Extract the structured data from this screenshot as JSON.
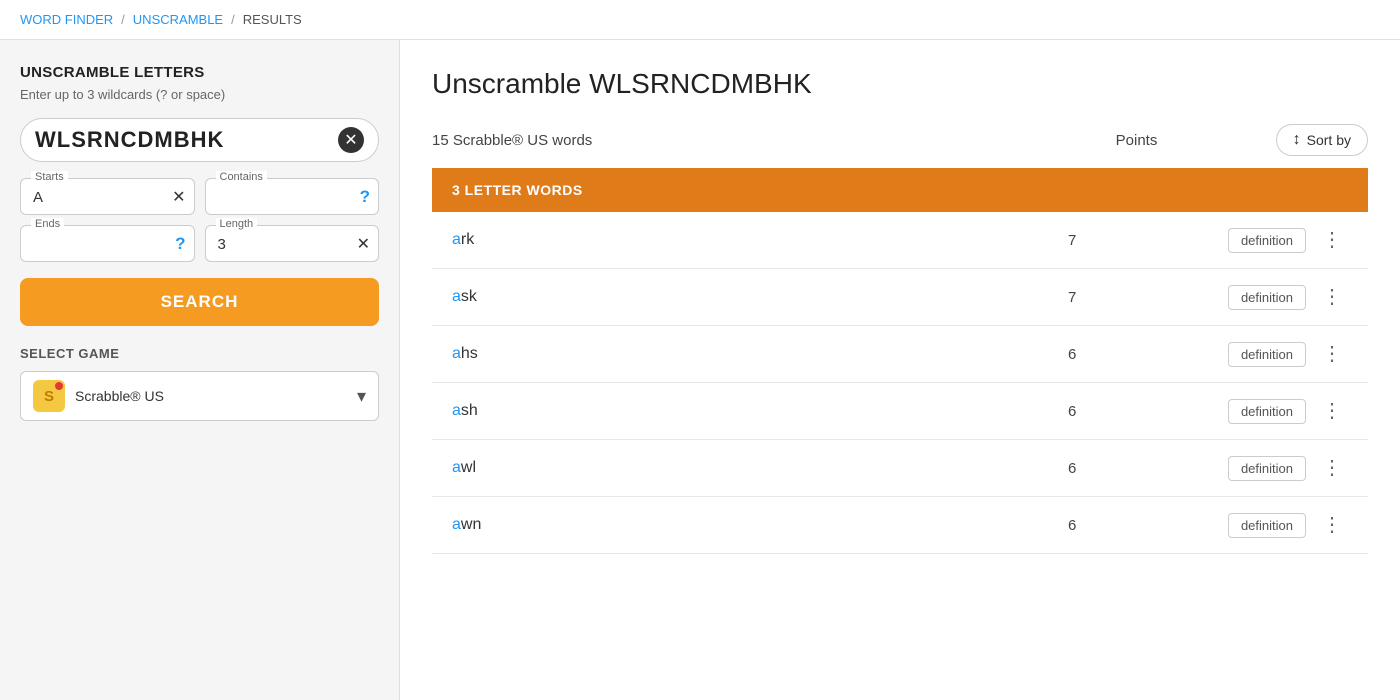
{
  "breadcrumb": {
    "items": [
      {
        "label": "WORD FINDER",
        "link": true
      },
      {
        "label": "UNSCRAMBLE",
        "link": true
      },
      {
        "label": "RESULTS",
        "link": false
      }
    ],
    "separators": [
      "/",
      "/"
    ]
  },
  "sidebar": {
    "title": "UNSCRAMBLE LETTERS",
    "subtitle": "Enter up to 3 wildcards (? or space)",
    "letters_value": "WLSRNCDMBHK",
    "starts_label": "Starts",
    "starts_value": "A",
    "contains_label": "Contains",
    "contains_value": "",
    "ends_label": "Ends",
    "ends_value": "",
    "length_label": "Length",
    "length_value": "3",
    "search_btn": "SEARCH",
    "select_game_label": "SELECT GAME",
    "game_name": "Scrabble® US",
    "game_icon_letter": "S",
    "clear_icon": "✕"
  },
  "results": {
    "page_title": "Unscramble WLSRNCDMBHK",
    "results_count": "15 Scrabble® US words",
    "points_column": "Points",
    "sort_by_label": "Sort by",
    "section_label": "3 LETTER WORDS",
    "words": [
      {
        "word": "ark",
        "first": "a",
        "rest": "rk",
        "points": 7
      },
      {
        "word": "ask",
        "first": "a",
        "rest": "sk",
        "points": 7
      },
      {
        "word": "ahs",
        "first": "a",
        "rest": "hs",
        "points": 6
      },
      {
        "word": "ash",
        "first": "a",
        "rest": "sh",
        "points": 6
      },
      {
        "word": "awl",
        "first": "a",
        "rest": "wl",
        "points": 6
      },
      {
        "word": "awn",
        "first": "a",
        "rest": "wn",
        "points": 6
      }
    ],
    "definition_btn_label": "definition"
  }
}
